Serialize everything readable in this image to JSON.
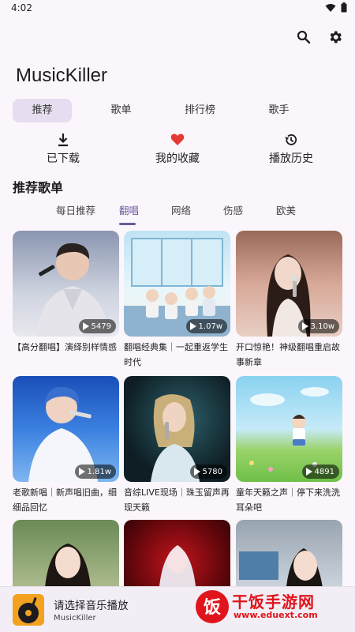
{
  "status": {
    "time": "4:02"
  },
  "app": {
    "title": "MusicKiller"
  },
  "main_tabs": [
    {
      "label": "推荐"
    },
    {
      "label": "歌单"
    },
    {
      "label": "排行榜"
    },
    {
      "label": "歌手"
    }
  ],
  "quick_actions": [
    {
      "label": "已下载",
      "icon": "download-icon"
    },
    {
      "label": "我的收藏",
      "icon": "heart-icon"
    },
    {
      "label": "播放历史",
      "icon": "history-icon"
    }
  ],
  "section": {
    "title": "推荐歌单"
  },
  "sub_tabs": [
    {
      "label": "每日推荐"
    },
    {
      "label": "翻唱"
    },
    {
      "label": "网络"
    },
    {
      "label": "伤感"
    },
    {
      "label": "欧美"
    }
  ],
  "playlists": [
    {
      "title": "【高分翻唱】演绎别样情感",
      "plays": "5479"
    },
    {
      "title": "翻唱经典集｜一起重返学生时代",
      "plays": "1.07w"
    },
    {
      "title": "开口惊艳！神级翻唱重启故事新章",
      "plays": "3.10w"
    },
    {
      "title": "老歌新唱｜新声唱旧曲，细细品回忆",
      "plays": "1.81w"
    },
    {
      "title": "音综LIVE现场｜珠玉留声再现天籁",
      "plays": "5780"
    },
    {
      "title": "童年天籁之声｜停下来洗洗耳朵吧",
      "plays": "4891"
    },
    {
      "title": "",
      "plays": ""
    },
    {
      "title": "",
      "plays": ""
    },
    {
      "title": "",
      "plays": ""
    }
  ],
  "player": {
    "title": "请选择音乐播放",
    "subtitle": "MusicKiller"
  },
  "watermark": {
    "name": "干饭手游网",
    "url": "www.eduext.com",
    "logo_char": "饭"
  }
}
